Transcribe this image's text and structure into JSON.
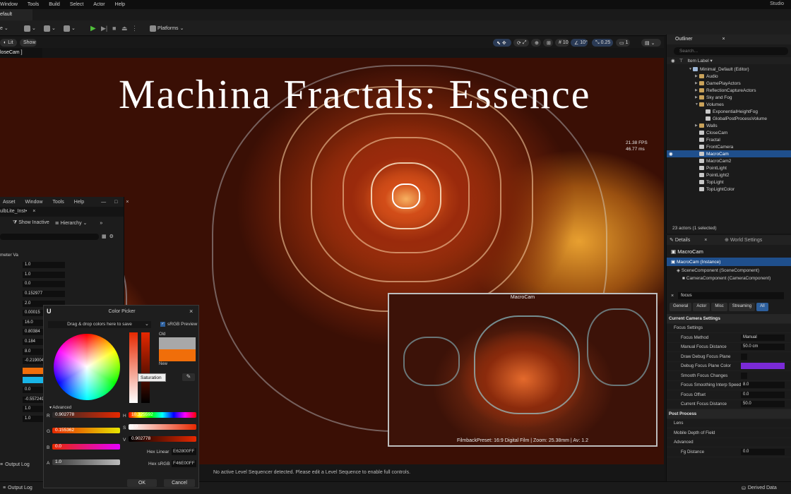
{
  "menubar": {
    "items": [
      "Window",
      "Tools",
      "Build",
      "Select",
      "Actor",
      "Help"
    ],
    "right_label": "Studio"
  },
  "doc_tab": {
    "label": "efault"
  },
  "toolbar": {
    "mode_label": "e",
    "platforms_label": "Platforms"
  },
  "viewport_toolbar": {
    "lit_label": "Lit",
    "show_label": "Show",
    "grid_value": "10",
    "angle_value": "10°",
    "scale_value": "0.25",
    "camera_speed": "1"
  },
  "viewport": {
    "camera_label": "loseCam ]",
    "title_text": "Machina Fractals: Essence",
    "fps_line1": "21.38 FPS",
    "fps_line2": "46.77 ms",
    "pip_title": "MacroCam",
    "pip_caption": "FilmbackPreset: 16:9 Digital Film | Zoom: 25.38mm | Av: 1.2"
  },
  "sequencer_message": "No active Level Sequencer detected. Please edit a Level Sequence to enable full controls.",
  "statusbar": {
    "output_log": "Output Log",
    "derived_data": "Derived Data"
  },
  "outliner": {
    "tab_label": "Outliner",
    "search_placeholder": "Search...",
    "column_header": "Item Label ▾",
    "rows": [
      {
        "label": "Minimal_Default (Editor)",
        "depth": 2,
        "kind": "world",
        "selected": false
      },
      {
        "label": "Audio",
        "depth": 3,
        "kind": "folder",
        "selected": false
      },
      {
        "label": "GamePlayActors",
        "depth": 3,
        "kind": "folder",
        "selected": false
      },
      {
        "label": "ReflectionCaptureActors",
        "depth": 3,
        "kind": "folder",
        "selected": false
      },
      {
        "label": "Sky and Fog",
        "depth": 3,
        "kind": "folder",
        "selected": false
      },
      {
        "label": "Volumes",
        "depth": 3,
        "kind": "folder",
        "selected": false
      },
      {
        "label": "ExponentialHeightFog",
        "depth": 4,
        "kind": "actor",
        "selected": false
      },
      {
        "label": "GlobalPostProcessVolume",
        "depth": 4,
        "kind": "actor",
        "selected": false
      },
      {
        "label": "Walls",
        "depth": 3,
        "kind": "folder",
        "selected": false
      },
      {
        "label": "CloseCam",
        "depth": 3,
        "kind": "actor",
        "selected": false
      },
      {
        "label": "Fractal",
        "depth": 3,
        "kind": "actor",
        "selected": false
      },
      {
        "label": "FrontCamera",
        "depth": 3,
        "kind": "actor",
        "selected": false
      },
      {
        "label": "MacroCam",
        "depth": 3,
        "kind": "actor",
        "selected": true
      },
      {
        "label": "MacroCam2",
        "depth": 3,
        "kind": "actor",
        "selected": false
      },
      {
        "label": "PointLight",
        "depth": 3,
        "kind": "actor",
        "selected": false
      },
      {
        "label": "PointLight2",
        "depth": 3,
        "kind": "actor",
        "selected": false
      },
      {
        "label": "TopLight",
        "depth": 3,
        "kind": "actor",
        "selected": false
      },
      {
        "label": "TopLightColor",
        "depth": 3,
        "kind": "actor",
        "selected": false
      }
    ],
    "footer": "23 actors (1 selected)"
  },
  "details": {
    "tab_label": "Details",
    "world_settings_label": "World Settings",
    "actor_name": "MacroCam",
    "instance_label": "MacroCam (Instance)",
    "component_1": "SceneComponent (SceneComponent)",
    "component_2": "CameraComponent (CameraComponent)",
    "search_value": "focus",
    "filter_tabs": [
      "General",
      "Actor",
      "Misc",
      "Streaming",
      "All"
    ],
    "rows": [
      {
        "label": "Current Camera Settings",
        "type": "cat",
        "value": ""
      },
      {
        "label": "Focus Settings",
        "type": "sub",
        "value": ""
      },
      {
        "label": "Focus Method",
        "type": "prop",
        "value": "Manual"
      },
      {
        "label": "Manual Focus Distance",
        "type": "prop",
        "value": "50.0 cm"
      },
      {
        "label": "Draw Debug Focus Plane",
        "type": "check",
        "value": ""
      },
      {
        "label": "Debug Focus Plane Color",
        "type": "color",
        "value": ""
      },
      {
        "label": "Smooth Focus Changes",
        "type": "check",
        "value": ""
      },
      {
        "label": "Focus Smoothing Interp Speed",
        "type": "prop",
        "value": "8.0"
      },
      {
        "label": "Focus Offset",
        "type": "prop",
        "value": "0.0"
      },
      {
        "label": "Current Focus Distance",
        "type": "prop",
        "value": "50.0"
      },
      {
        "label": "Post Process",
        "type": "cat",
        "value": ""
      },
      {
        "label": "Lens",
        "type": "sub",
        "value": ""
      },
      {
        "label": "Mobile Depth of Field",
        "type": "sub",
        "value": ""
      },
      {
        "label": "Advanced",
        "type": "sub",
        "value": ""
      },
      {
        "label": "Fg Distance",
        "type": "prop",
        "value": "0.0"
      }
    ]
  },
  "left_panel": {
    "menu": [
      "Asset",
      "Window",
      "Tools",
      "Help"
    ],
    "tab_label": "ulbLite_Inst•",
    "show_inactive": "Show Inactive",
    "hierarchy": "Hierarchy",
    "section_1": "meter Va",
    "section_2": "meter Va",
    "values": [
      "1.0",
      "1.0",
      "0.0",
      "0.152977",
      "2.0",
      "0.00015",
      "16.0",
      "0.80384",
      "0.184",
      "8.0",
      "-0.219004",
      "",
      "",
      "0.0",
      "-0.557249",
      "1.0",
      "1.0"
    ],
    "output_log": "Output Log"
  },
  "color_picker": {
    "title": "Color Picker",
    "drag_hint": "Drag & drop colors here to save",
    "srgb_preview": "sRGB Preview",
    "old_label": "Old",
    "new_label": "New",
    "tooltip": "Saturation",
    "advanced": "Advanced",
    "R": "0.902778",
    "G": "0.155362",
    "B": "0.0",
    "A": "1.0",
    "H": "10.325592",
    "S": "1.0",
    "V": "0.902778",
    "hex_linear_label": "Hex Linear",
    "hex_linear": "E62800FF",
    "hex_srgb_label": "Hex sRGB",
    "hex_srgb": "F46E00FF",
    "ok": "OK",
    "cancel": "Cancel",
    "old_color": "#a8a8a8",
    "new_color": "#f06e0a"
  }
}
